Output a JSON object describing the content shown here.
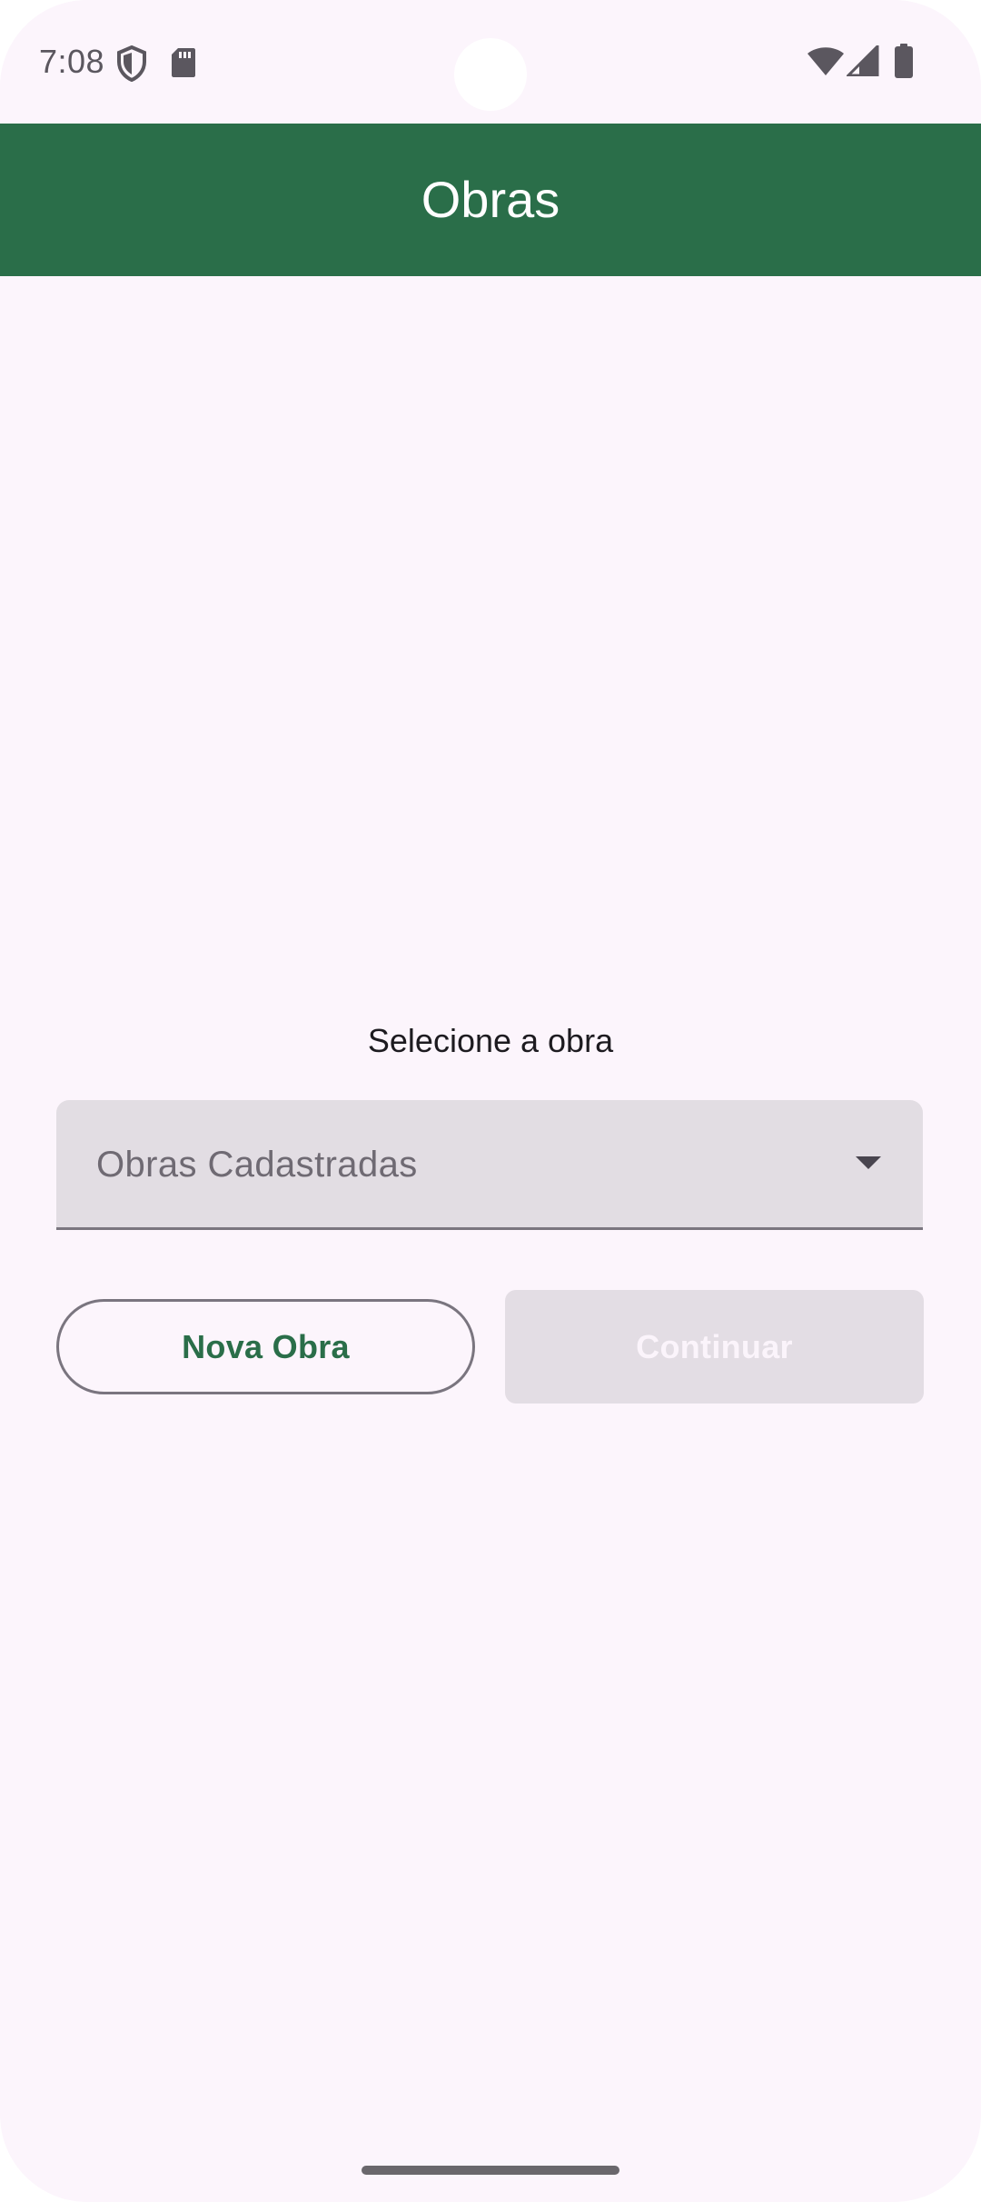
{
  "status_bar": {
    "time": "7:08",
    "icons": [
      "shield-icon",
      "sd-card-icon",
      "wifi-icon",
      "cell-signal-icon",
      "battery-icon"
    ]
  },
  "app_bar": {
    "title": "Obras",
    "color": "#2a6e49"
  },
  "content": {
    "select_label": "Selecione a obra",
    "dropdown": {
      "placeholder": "Obras Cadastradas",
      "selected_value": ""
    },
    "buttons": {
      "new_label": "Nova Obra",
      "continue_label": "Continuar",
      "continue_enabled": false
    }
  },
  "colors": {
    "background": "#fcf5fc",
    "accent": "#2a6e49",
    "dropdown_fill": "#e2dde3",
    "disabled_button": "#e3dde4"
  }
}
